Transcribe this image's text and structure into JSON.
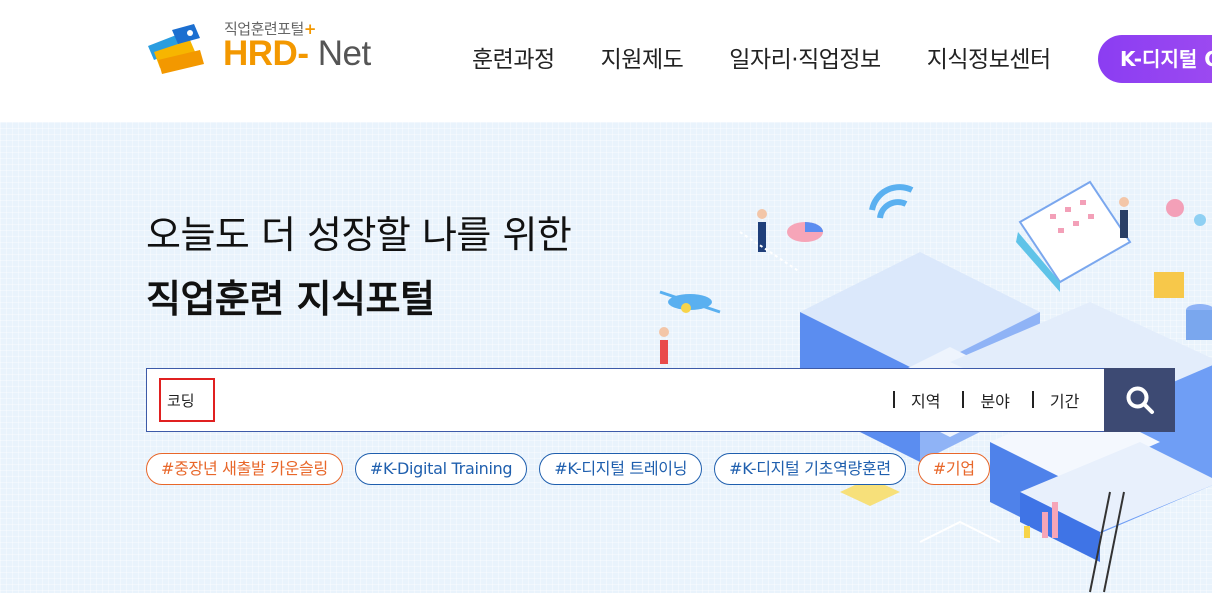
{
  "header": {
    "logo_sub": "직업훈련포털",
    "logo_plus": "+",
    "logo_hrd": "HRD-",
    "logo_net": " Net",
    "nav": [
      "훈련과정",
      "지원제도",
      "일자리·직업정보",
      "지식정보센터"
    ],
    "kdigital_button": "K-디지털 C"
  },
  "hero": {
    "line1": "오늘도 더 성장할 나를 위한",
    "line2": "직업훈련 지식포털"
  },
  "search": {
    "value": "코딩",
    "filters": [
      "지역",
      "분야",
      "기간"
    ],
    "button_icon": "search-icon"
  },
  "tags": [
    {
      "label": "#중장년 새출발 카운슬링",
      "color": "orange"
    },
    {
      "label": "#K-Digital Training",
      "color": "blue"
    },
    {
      "label": "#K-디지털 트레이닝",
      "color": "blue"
    },
    {
      "label": "#K-디지털 기초역량훈련",
      "color": "blue"
    },
    {
      "label": "#기업",
      "color": "orange"
    }
  ],
  "colors": {
    "accent_orange": "#f39800",
    "tag_orange": "#e8672a",
    "tag_blue": "#1f5fae",
    "search_button": "#3d4a73",
    "kdigital_purple": "#8b3df2"
  }
}
